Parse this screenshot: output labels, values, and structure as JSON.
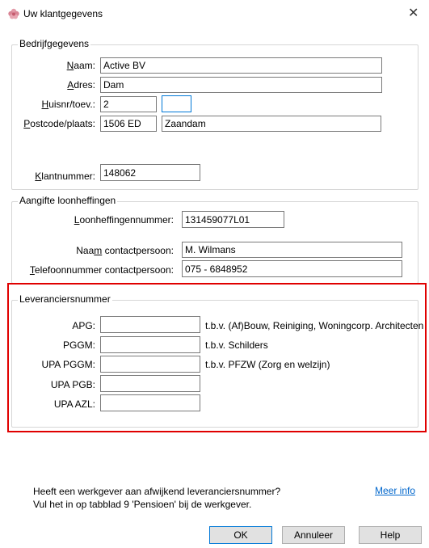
{
  "window": {
    "title": "Uw klantgegevens",
    "close_glyph": "✕",
    "icon": "flower-icon"
  },
  "bedrijf": {
    "legend": "Bedrijfgegevens",
    "naam_label": {
      "pre": "",
      "u": "N",
      "post": "aam:"
    },
    "naam_value": "Active BV",
    "adres_label": {
      "pre": "",
      "u": "A",
      "post": "dres:"
    },
    "adres_value": "Dam",
    "huisnr_label": {
      "pre": "",
      "u": "H",
      "post": "uisnr/toev.:"
    },
    "huisnr_value": "2",
    "toev_value": "",
    "postcode_label": {
      "pre": "",
      "u": "P",
      "post": "ostcode/plaats:"
    },
    "postcode_value": "1506 ED",
    "plaats_value": "Zaandam",
    "klantnummer_label": {
      "pre": "",
      "u": "K",
      "post": "lantnummer:"
    },
    "klantnummer_value": "148062"
  },
  "loon": {
    "legend": "Aangifte loonheffingen",
    "nummer_label": {
      "pre": "",
      "u": "L",
      "post": "oonheffingennummer:"
    },
    "nummer_value": "131459077L01",
    "contact_label": {
      "pre": "Naa",
      "u": "m",
      "post": " contactpersoon:"
    },
    "contact_value": "M. Wilmans",
    "telefoon_label": {
      "pre": "",
      "u": "T",
      "post": "elefoonnummer contactpersoon:"
    },
    "telefoon_value": "075 - 6848952"
  },
  "leverancier": {
    "legend": "Leveranciersnummer",
    "rows": [
      {
        "label": "APG:",
        "value": "",
        "note": "t.b.v. (Af)Bouw, Reiniging, Woningcorp. Architecten"
      },
      {
        "label": "PGGM:",
        "value": "",
        "note": "t.b.v. Schilders"
      },
      {
        "label": "UPA PGGM:",
        "value": "",
        "note": "t.b.v. PFZW (Zorg en welzijn)"
      },
      {
        "label": "UPA PGB:",
        "value": "",
        "note": ""
      },
      {
        "label": "UPA AZL:",
        "value": "",
        "note": ""
      }
    ]
  },
  "info": {
    "line1": "Heeft een werkgever aan afwijkend leveranciersnummer?",
    "line2": "Vul het in op tabblad 9 'Pensioen' bij de werkgever.",
    "link": "Meer info"
  },
  "buttons": {
    "ok": "OK",
    "cancel": "Annuleer",
    "help": "Help"
  },
  "colors": {
    "highlight": "#e00000",
    "link": "#0066cc",
    "focus": "#0078d7"
  }
}
